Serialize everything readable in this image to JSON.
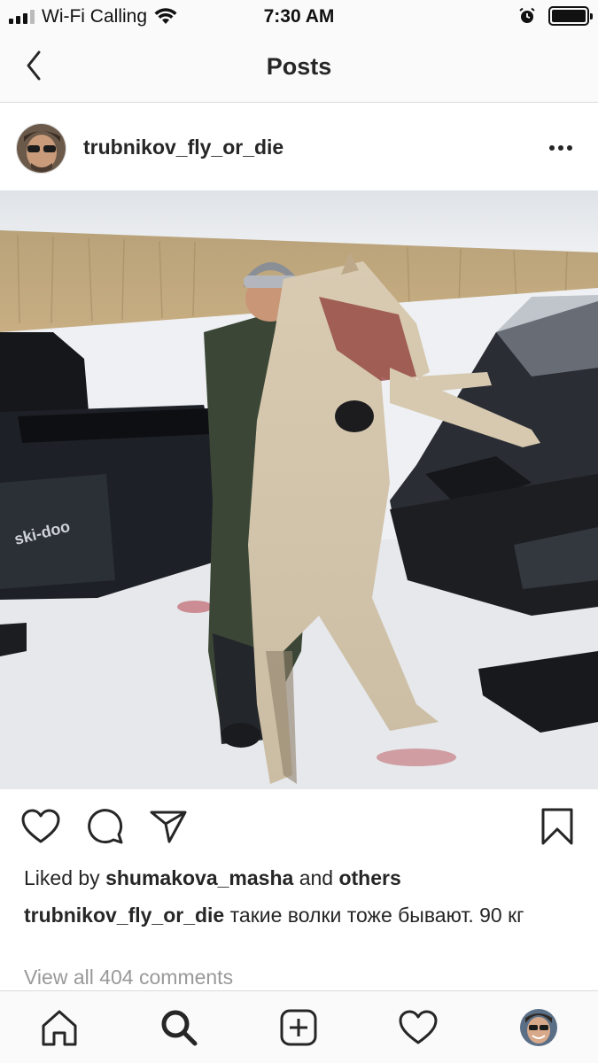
{
  "status_bar": {
    "carrier": "Wi-Fi Calling",
    "time": "7:30 AM"
  },
  "header": {
    "title": "Posts"
  },
  "post": {
    "username": "trubnikov_fly_or_die",
    "likes_prefix": "Liked by",
    "likes_user": "shumakova_masha",
    "likes_and": "and",
    "likes_others": "others",
    "caption_user": "trubnikov_fly_or_die",
    "caption_text": "такие волки тоже бывают. 90 кг",
    "view_comments": "View all 404 comments"
  },
  "icons": {
    "back": "chevron-left-icon",
    "more": "more-icon",
    "like": "heart-icon",
    "comment": "comment-icon",
    "share": "send-icon",
    "save": "bookmark-icon",
    "home": "home-icon",
    "search": "search-icon",
    "add": "add-icon",
    "activity": "heart-icon"
  }
}
